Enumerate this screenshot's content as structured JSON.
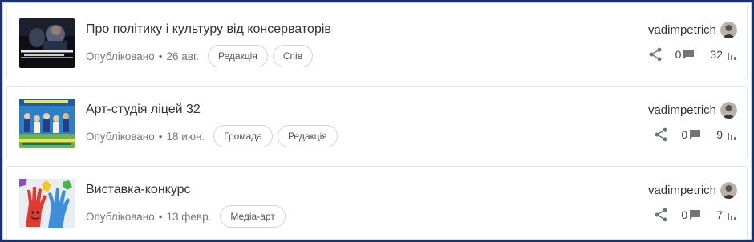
{
  "posts": [
    {
      "title": "Про політику і культуру від консерваторів",
      "status": "Опубліковано",
      "date": "26 авг.",
      "tags": [
        "Редакція",
        "Спів"
      ],
      "author": "vadimpetrich",
      "comments": "0",
      "views": "32",
      "thumbnail": "dark-video-still"
    },
    {
      "title": "Арт-студія ліцей 32",
      "status": "Опубліковано",
      "date": "18 июн.",
      "tags": [
        "Громада",
        "Редакція"
      ],
      "author": "vadimpetrich",
      "comments": "0",
      "views": "9",
      "thumbnail": "school-banner-photo"
    },
    {
      "title": "Виставка-конкурс",
      "status": "Опубліковано",
      "date": "13 февр.",
      "tags": [
        "Медіа-арт"
      ],
      "author": "vadimpetrich",
      "comments": "0",
      "views": "7",
      "thumbnail": "painted-hands-art"
    }
  ],
  "separator": "•",
  "icons": {
    "share": "share-icon",
    "comments": "comment-icon",
    "views": "bar-chart-icon"
  },
  "colors": {
    "frame_border": "#1e2f6e",
    "card_border": "#dfe3ea",
    "tag_border": "#cfd4da",
    "icon_gray": "#6f7478"
  }
}
